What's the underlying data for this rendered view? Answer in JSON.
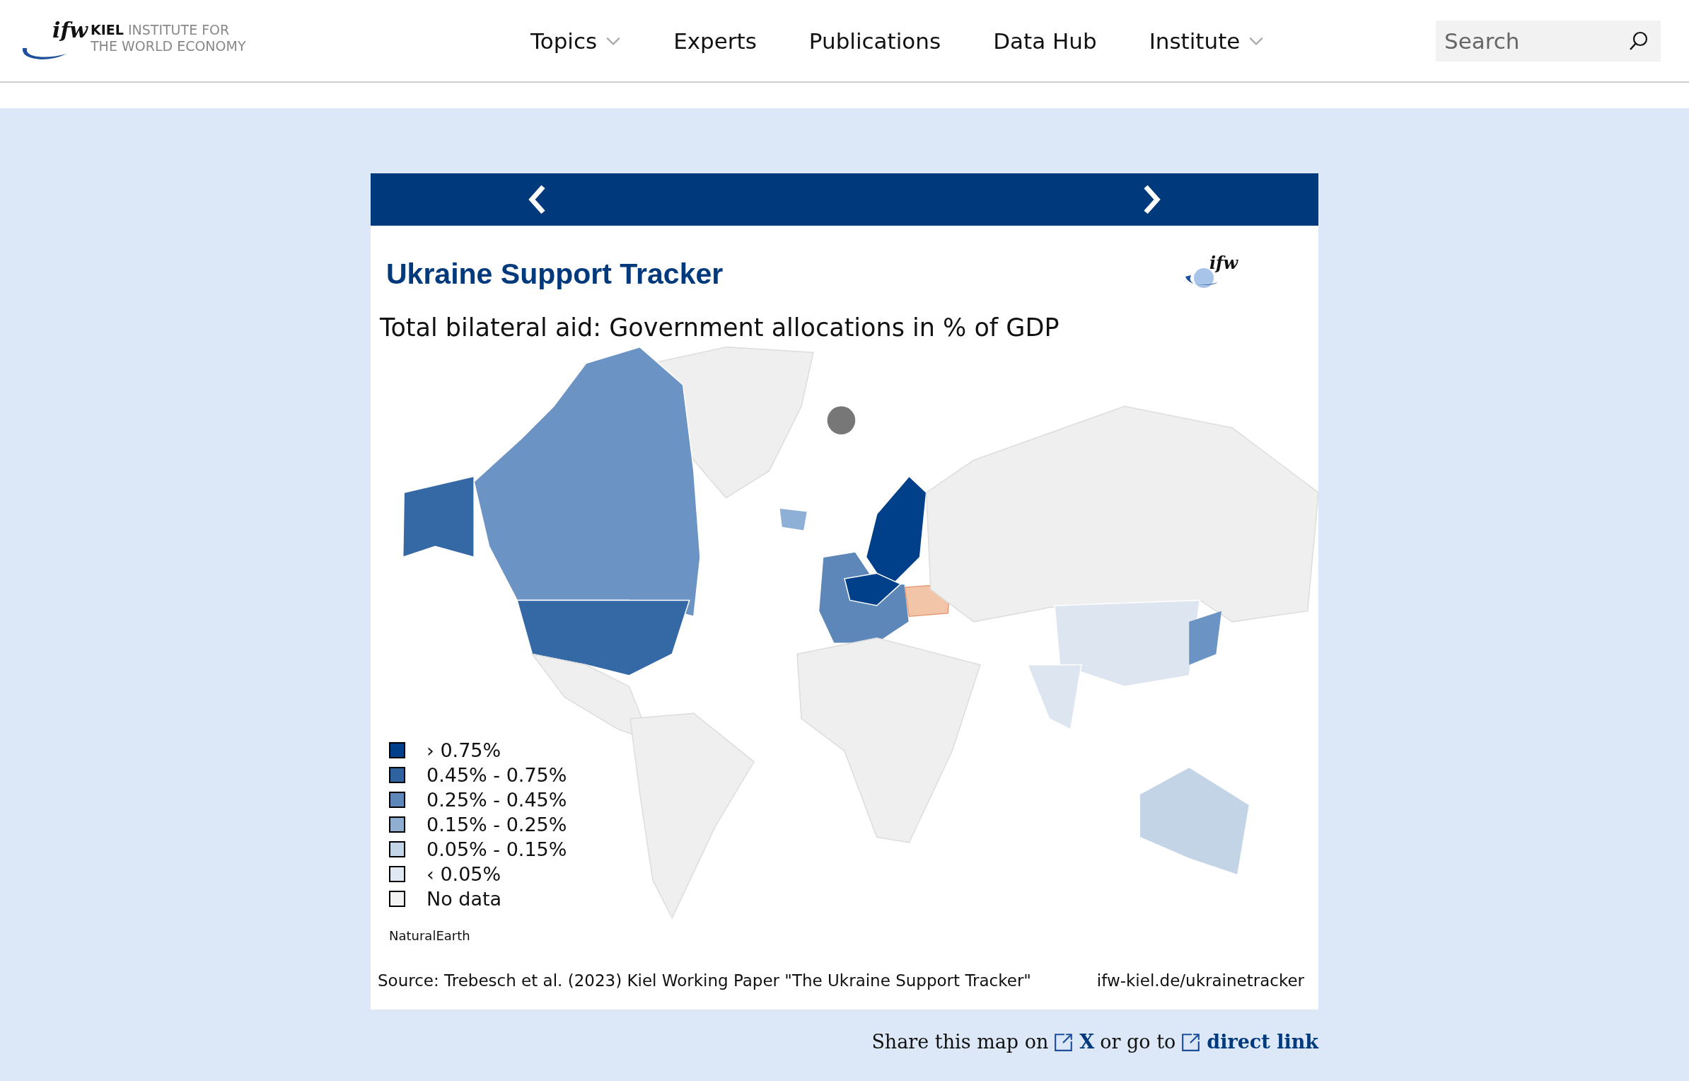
{
  "header": {
    "logo": {
      "mark": "ifw",
      "line_1": "KIEL",
      "line_1_rest": "INSTITUTE FOR",
      "line_2": "THE WORLD ECONOMY"
    },
    "nav": [
      {
        "label": "Topics",
        "dropdown": true
      },
      {
        "label": "Experts",
        "dropdown": false
      },
      {
        "label": "Publications",
        "dropdown": false
      },
      {
        "label": "Data Hub",
        "dropdown": false
      },
      {
        "label": "Institute",
        "dropdown": true
      }
    ],
    "search": {
      "placeholder": "Search"
    }
  },
  "card": {
    "title": "Ukraine Support Tracker",
    "logo_mark": "ifw",
    "subtitle": "Total bilateral aid: Government allocations in % of GDP",
    "legend": [
      {
        "label": "› 0.75%",
        "color": "#003f8a"
      },
      {
        "label": "0.45% - 0.75%",
        "color": "#2f63a0"
      },
      {
        "label": "0.25% - 0.45%",
        "color": "#5d87b8"
      },
      {
        "label": "0.15% - 0.25%",
        "color": "#8faed0"
      },
      {
        "label": "0.05% - 0.15%",
        "color": "#c5d5e8"
      },
      {
        "label": "‹ 0.05%",
        "color": "#e0e8f2"
      },
      {
        "label": "No data",
        "color": "#f2f2f2"
      }
    ],
    "attribution": "NaturalEarth",
    "source": "Source: Trebesch et al. (2023) Kiel Working Paper \"The Ukraine Support Tracker\"",
    "url": "ifw-kiel.de/ukrainetracker"
  },
  "share": {
    "text_1": "Share this map on",
    "link_1": "X",
    "text_2": "or go to",
    "link_2": "direct link"
  }
}
